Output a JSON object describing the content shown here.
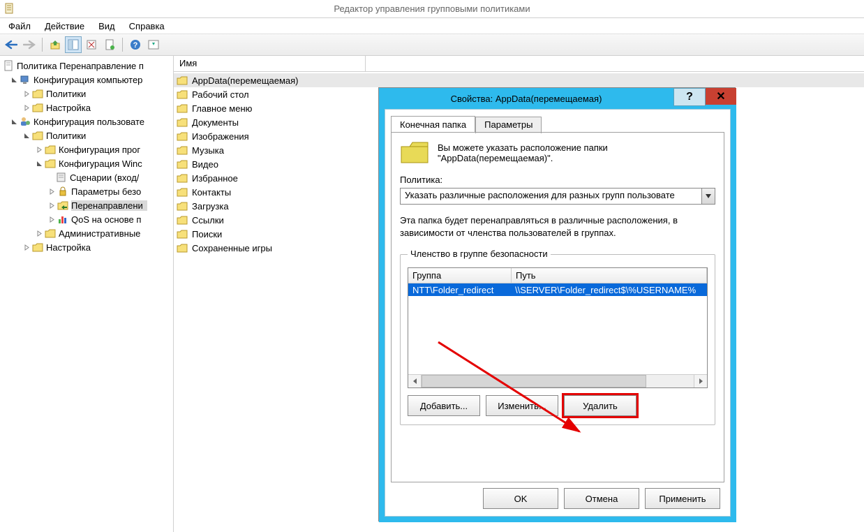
{
  "window": {
    "title": "Редактор управления групповыми политиками"
  },
  "menu": {
    "file": "Файл",
    "action": "Действие",
    "view": "Вид",
    "help": "Справка"
  },
  "tree": {
    "root": "Политика Перенаправление п",
    "computer_cfg": "Конфигурация компьютер",
    "policies": "Политики",
    "settings": "Настройка",
    "user_cfg": "Конфигурация пользовате",
    "user_policies": "Политики",
    "soft_cfg": "Конфигурация прог",
    "win_cfg": "Конфигурация Winc",
    "scripts": "Сценарии (вход/",
    "security": "Параметры безо",
    "redirect": "Перенаправлени",
    "qos": "QoS на основе п",
    "admin": "Административные",
    "user_settings": "Настройка"
  },
  "list": {
    "col_name": "Имя",
    "items": [
      "AppData(перемещаемая)",
      "Рабочий стол",
      "Главное меню",
      "Документы",
      "Изображения",
      "Музыка",
      "Видео",
      "Избранное",
      "Контакты",
      "Загрузка",
      "Ссылки",
      "Поиски",
      "Сохраненные игры"
    ]
  },
  "dialog": {
    "title": "Свойства: AppData(перемещаемая)",
    "help": "?",
    "close": "✕",
    "tab_target": "Конечная папка",
    "tab_params": "Параметры",
    "info": "Вы можете указать расположение папки \"AppData(перемещаемая)\".",
    "policy_label": "Политика:",
    "policy_value": "Указать различные расположения для разных групп пользовате",
    "desc": "Эта папка будет перенаправляться в различные расположения, в зависимости от членства пользователей в группах.",
    "group_box": "Членство в группе безопасности",
    "col_group": "Группа",
    "col_path": "Путь",
    "row_group": "NTT\\Folder_redirect",
    "row_path": "\\\\SERVER\\Folder_redirect$\\%USERNAME%",
    "add": "Добавить...",
    "edit": "Изменить...",
    "delete": "Удалить",
    "ok": "OK",
    "cancel": "Отмена",
    "apply": "Применить"
  }
}
